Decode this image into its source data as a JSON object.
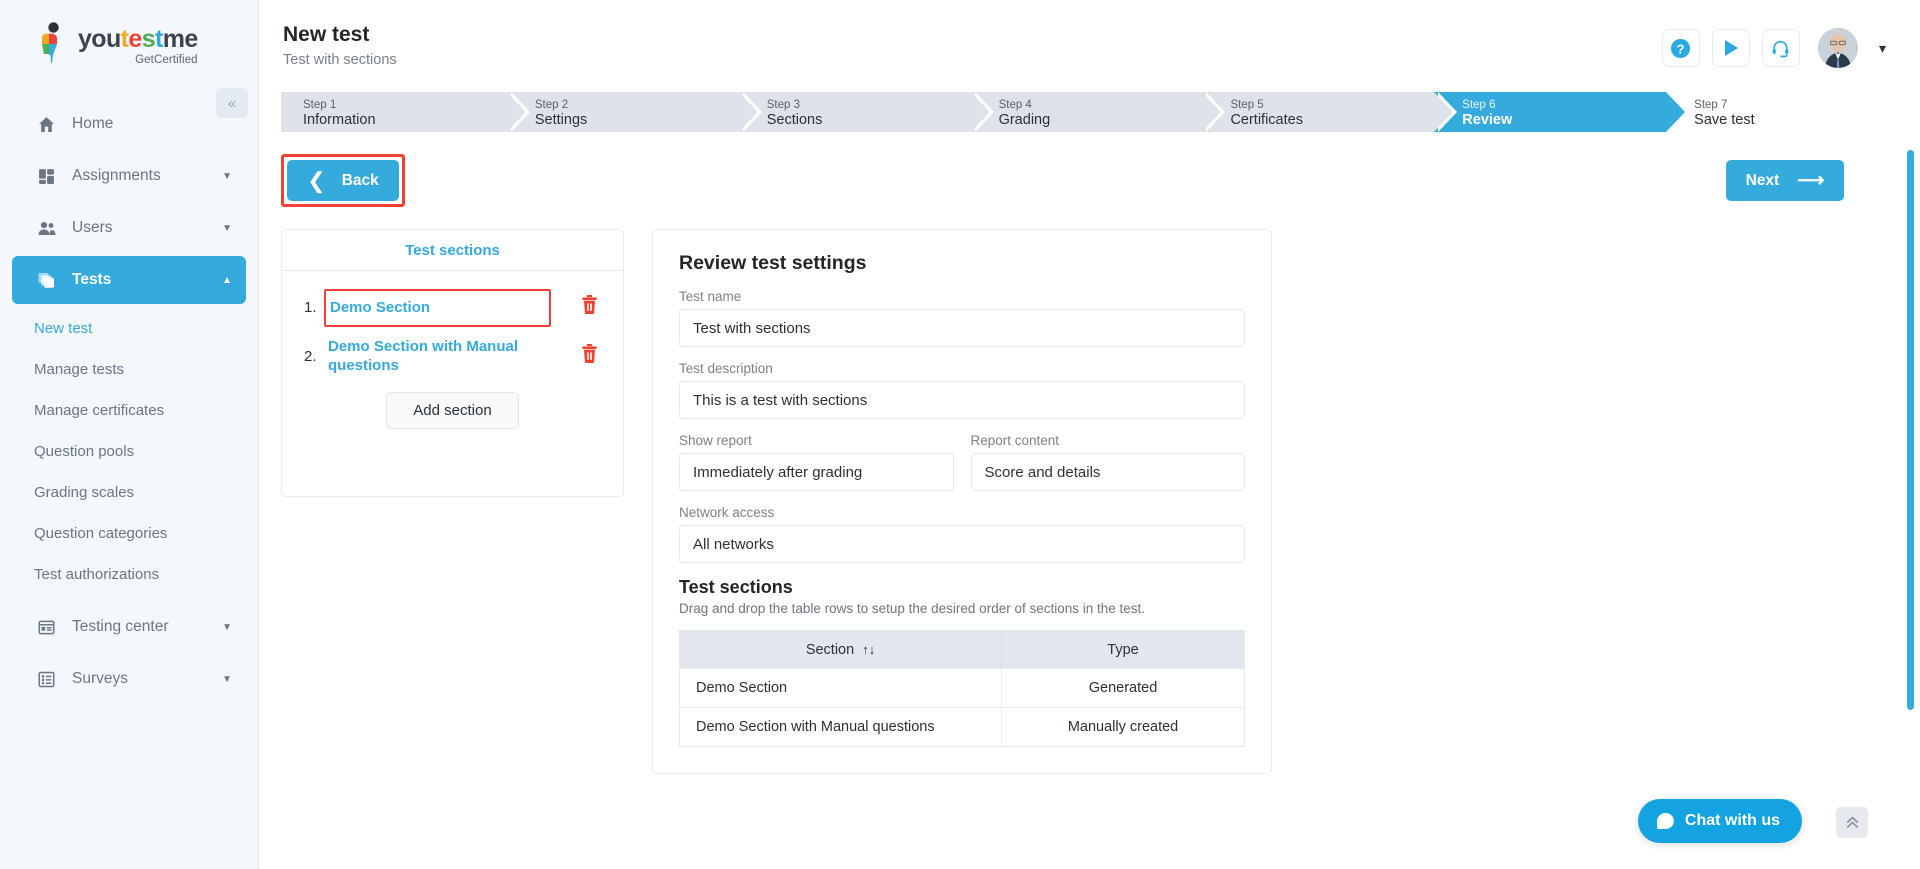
{
  "brand": {
    "word_parts": [
      "you",
      "t",
      "e",
      "s",
      "t",
      "me"
    ],
    "name": "youtestme",
    "tagline": "GetCertified",
    "accent": "#35aadc"
  },
  "sidebar": {
    "collapse_icon": "chevron-double-left-icon",
    "items": [
      {
        "label": "Home",
        "icon": "home-icon",
        "active": false,
        "caret": false
      },
      {
        "label": "Assignments",
        "icon": "assignments-icon",
        "active": false,
        "caret": true
      },
      {
        "label": "Users",
        "icon": "users-icon",
        "active": false,
        "caret": true
      },
      {
        "label": "Tests",
        "icon": "tests-icon",
        "active": true,
        "caret": true
      }
    ],
    "sub_items": [
      {
        "label": "New test",
        "selected": true
      },
      {
        "label": "Manage tests",
        "selected": false
      },
      {
        "label": "Manage certificates",
        "selected": false
      },
      {
        "label": "Question pools",
        "selected": false
      },
      {
        "label": "Grading scales",
        "selected": false
      },
      {
        "label": "Question categories",
        "selected": false
      },
      {
        "label": "Test authorizations",
        "selected": false
      }
    ],
    "bottom_items": [
      {
        "label": "Testing center",
        "icon": "testing-center-icon",
        "caret": true
      },
      {
        "label": "Surveys",
        "icon": "surveys-icon",
        "caret": true
      }
    ]
  },
  "header": {
    "title": "New test",
    "subtitle": "Test with sections",
    "actions": [
      {
        "name": "help-icon",
        "glyph": "?"
      },
      {
        "name": "play-icon",
        "glyph": "▶"
      },
      {
        "name": "support-headset-icon",
        "glyph": "Ἲ7"
      }
    ],
    "avatar_chevron": "chevron-down-icon"
  },
  "wizard": {
    "steps": [
      {
        "num": "Step 1",
        "name": "Information",
        "state": "inactive"
      },
      {
        "num": "Step 2",
        "name": "Settings",
        "state": "inactive"
      },
      {
        "num": "Step 3",
        "name": "Sections",
        "state": "inactive"
      },
      {
        "num": "Step 4",
        "name": "Grading",
        "state": "inactive"
      },
      {
        "num": "Step 5",
        "name": "Certificates",
        "state": "inactive"
      },
      {
        "num": "Step 6",
        "name": "Review",
        "state": "active"
      },
      {
        "num": "Step 7",
        "name": "Save test",
        "state": "plain"
      }
    ]
  },
  "nav_buttons": {
    "back_label": "Back",
    "back_icon": "chevron-left-icon",
    "back_highlight_color": "#ef4136",
    "next_label": "Next",
    "next_icon": "arrow-right-icon"
  },
  "sections_panel": {
    "header": "Test sections",
    "items": [
      {
        "num": "1.",
        "name": "Demo Section",
        "highlighted": true
      },
      {
        "num": "2.",
        "name": "Demo Section with Manual questions",
        "highlighted": false
      }
    ],
    "delete_icon": "trash-icon",
    "add_button_label": "Add section"
  },
  "review": {
    "title": "Review test settings",
    "fields": [
      {
        "label": "Test name",
        "value": "Test with sections"
      },
      {
        "label": "Test description",
        "value": "This is a test with sections"
      }
    ],
    "row_fields": [
      {
        "label": "Show report",
        "value": "Immediately after grading"
      },
      {
        "label": "Report content",
        "value": "Score and details"
      }
    ],
    "network_field": {
      "label": "Network access",
      "value": "All networks"
    },
    "sections_heading": "Test sections",
    "sections_description": "Drag and drop the table rows to setup the desired order of sections in the test.",
    "table": {
      "columns": [
        "Section",
        "Type"
      ],
      "sort_glyph": "↑↓",
      "rows": [
        {
          "section": "Demo Section",
          "type": "Generated"
        },
        {
          "section": "Demo Section with Manual questions",
          "type": "Manually created"
        }
      ]
    }
  },
  "chat": {
    "label": "Chat with us",
    "icon": "chat-bubble-icon",
    "scroll_top_icon": "chevron-double-up-icon"
  }
}
